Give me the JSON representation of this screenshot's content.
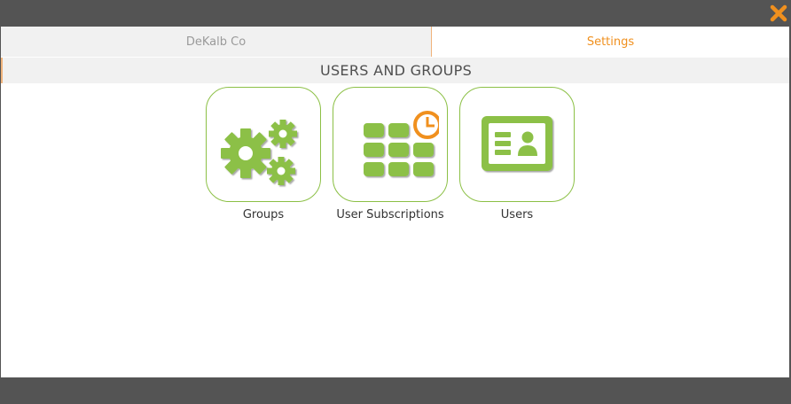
{
  "tabs": [
    {
      "label": "DeKalb Co",
      "active": false
    },
    {
      "label": "Settings",
      "active": true
    }
  ],
  "section": {
    "title": "USERS AND GROUPS"
  },
  "tiles": [
    {
      "label": "Groups",
      "icon": "gears-icon"
    },
    {
      "label": "User Subscriptions",
      "icon": "subscription-grid-clock-icon"
    },
    {
      "label": "Users",
      "icon": "id-card-icon"
    }
  ],
  "colors": {
    "accent_orange": "#f0901e",
    "icon_green": "#8cc046",
    "frame_dark": "#545454"
  }
}
